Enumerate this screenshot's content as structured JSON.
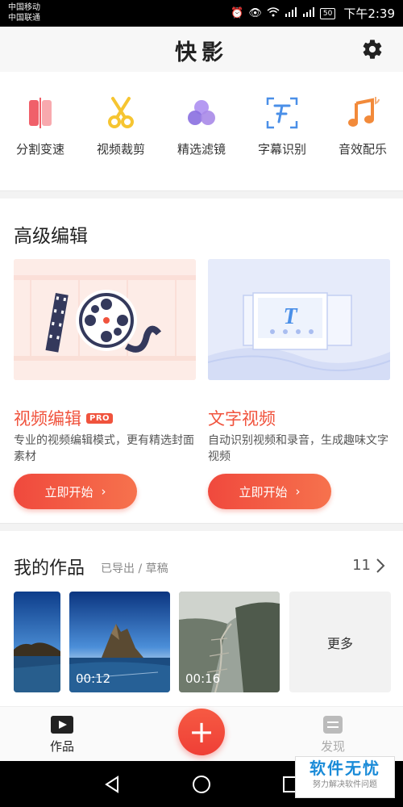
{
  "status_bar": {
    "carrier_1": "中国移动",
    "carrier_2": "中国联通",
    "battery": "50",
    "time": "下午2:39"
  },
  "header": {
    "title": "快影",
    "settings_icon": "gear-icon"
  },
  "tools": [
    {
      "label": "分割变速",
      "icon": "split-speed-icon",
      "color": "#f0606a"
    },
    {
      "label": "视频裁剪",
      "icon": "scissors-icon",
      "color": "#f6c531"
    },
    {
      "label": "精选滤镜",
      "icon": "filter-circles-icon",
      "color": "#8a6fe0"
    },
    {
      "label": "字幕识别",
      "icon": "subtitle-recognition-icon",
      "color": "#4a8fe8"
    },
    {
      "label": "音效配乐",
      "icon": "music-note-icon",
      "color": "#f28a3a"
    }
  ],
  "advanced": {
    "title": "高级编辑",
    "video_edit": {
      "title": "视频编辑",
      "badge": "PRO",
      "desc": "专业的视频编辑模式，更有精选封面素材",
      "button": "立即开始"
    },
    "text_video": {
      "title": "文字视频",
      "desc": "自动识别视频和录音，生成趣味文字视频",
      "button": "立即开始"
    }
  },
  "works": {
    "title": "我的作品",
    "subtitle": "已导出 / 草稿",
    "count": "11",
    "items": [
      {
        "duration": ""
      },
      {
        "duration": "00:12"
      },
      {
        "duration": "00:16"
      }
    ],
    "more": "更多"
  },
  "bottom_nav": {
    "works": "作品",
    "discover": "发现",
    "add": "+"
  },
  "watermark": {
    "main": "软件无忧",
    "sub": "努力解决软件问题"
  },
  "colors": {
    "accent": "#f0533d",
    "card_edit_bg": "#fdece7",
    "card_text_bg": "#e6ebfa"
  }
}
